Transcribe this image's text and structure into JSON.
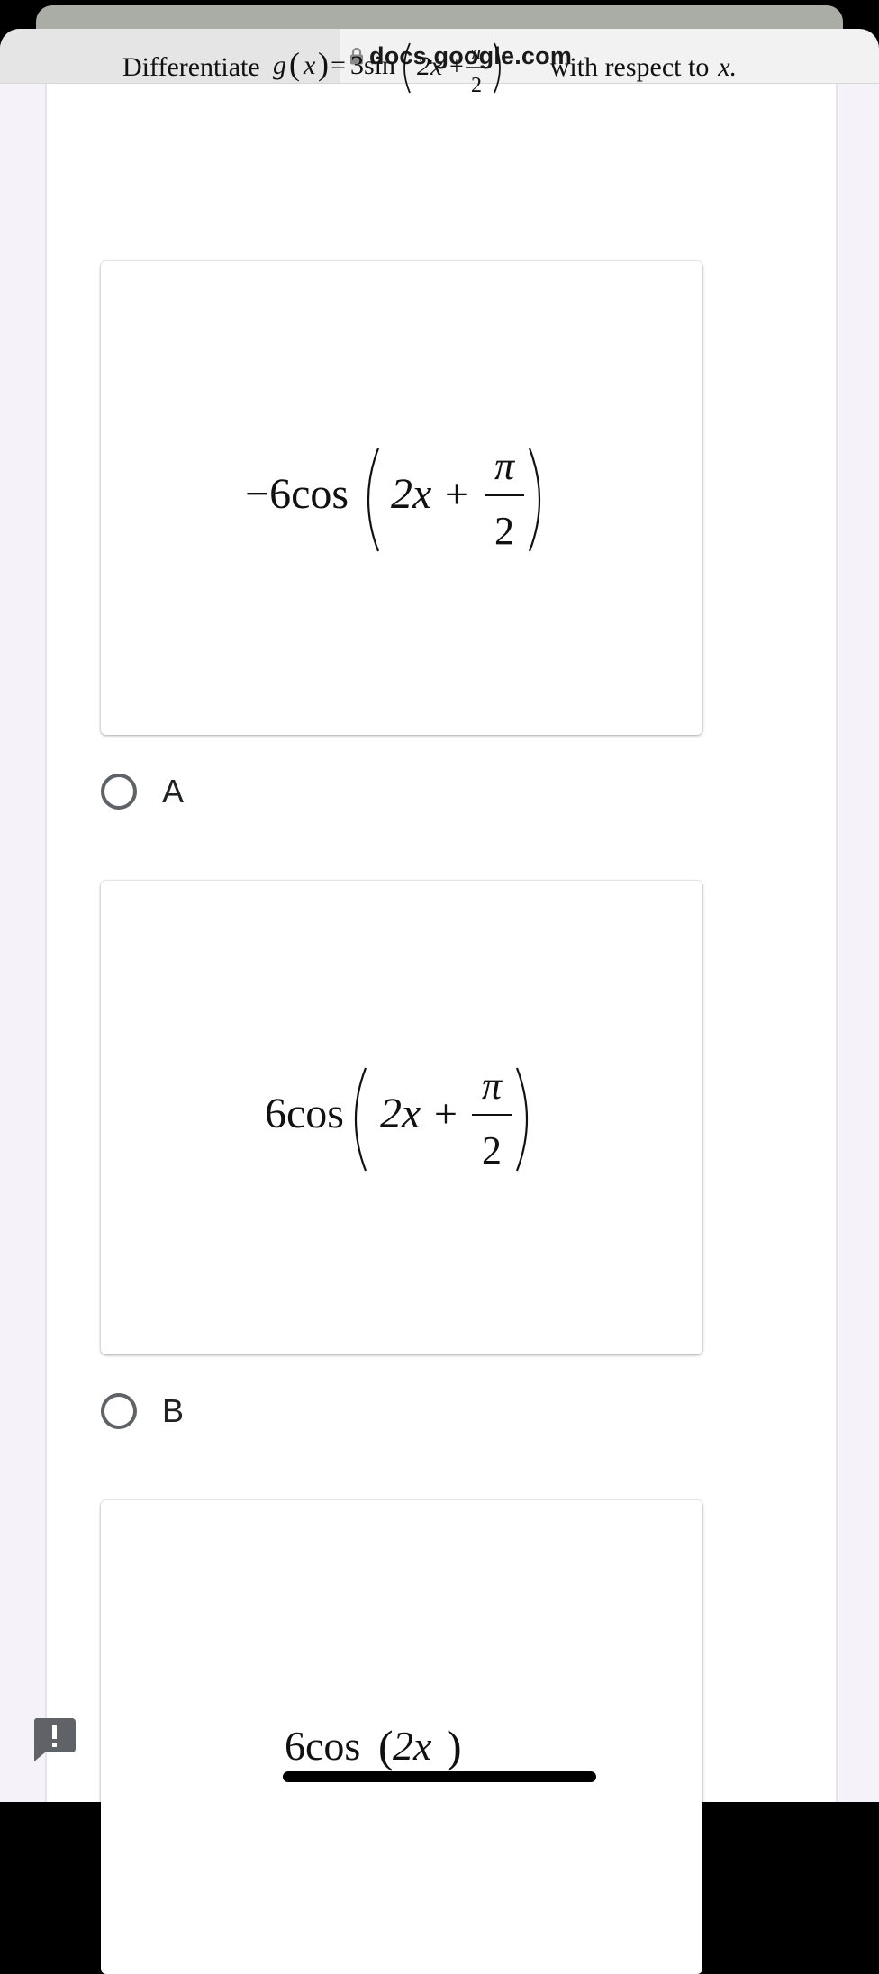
{
  "browser": {
    "url": "docs.google.com"
  },
  "icons": {
    "lock": "lock-icon",
    "radio": "radio-circle-icon",
    "feedback": "exclamation-feedback-icon"
  },
  "question": {
    "prefix": "Differentiate",
    "formula": {
      "func": "g",
      "var": "x",
      "equals": "=",
      "coef": "3sin",
      "inner": "2x",
      "plus": "+",
      "numerator": "π",
      "denominator": "2"
    },
    "suffix": "with respect to",
    "variable": "x."
  },
  "options": [
    {
      "label": "A",
      "formula": {
        "coef": "−6cos",
        "inner": "2x",
        "plus": "+",
        "numerator": "π",
        "denominator": "2"
      }
    },
    {
      "label": "B",
      "formula": {
        "coef": "6cos",
        "inner": "2x",
        "plus": "+",
        "numerator": "π",
        "denominator": "2"
      }
    },
    {
      "label": "",
      "formula": {
        "coef": "6cos",
        "inner": "2x"
      }
    }
  ],
  "colors": {
    "page_background": "#f6f2fa",
    "card_background": "#ffffff",
    "radio_border": "#5f6368",
    "feedback_button": "#5f6368"
  }
}
